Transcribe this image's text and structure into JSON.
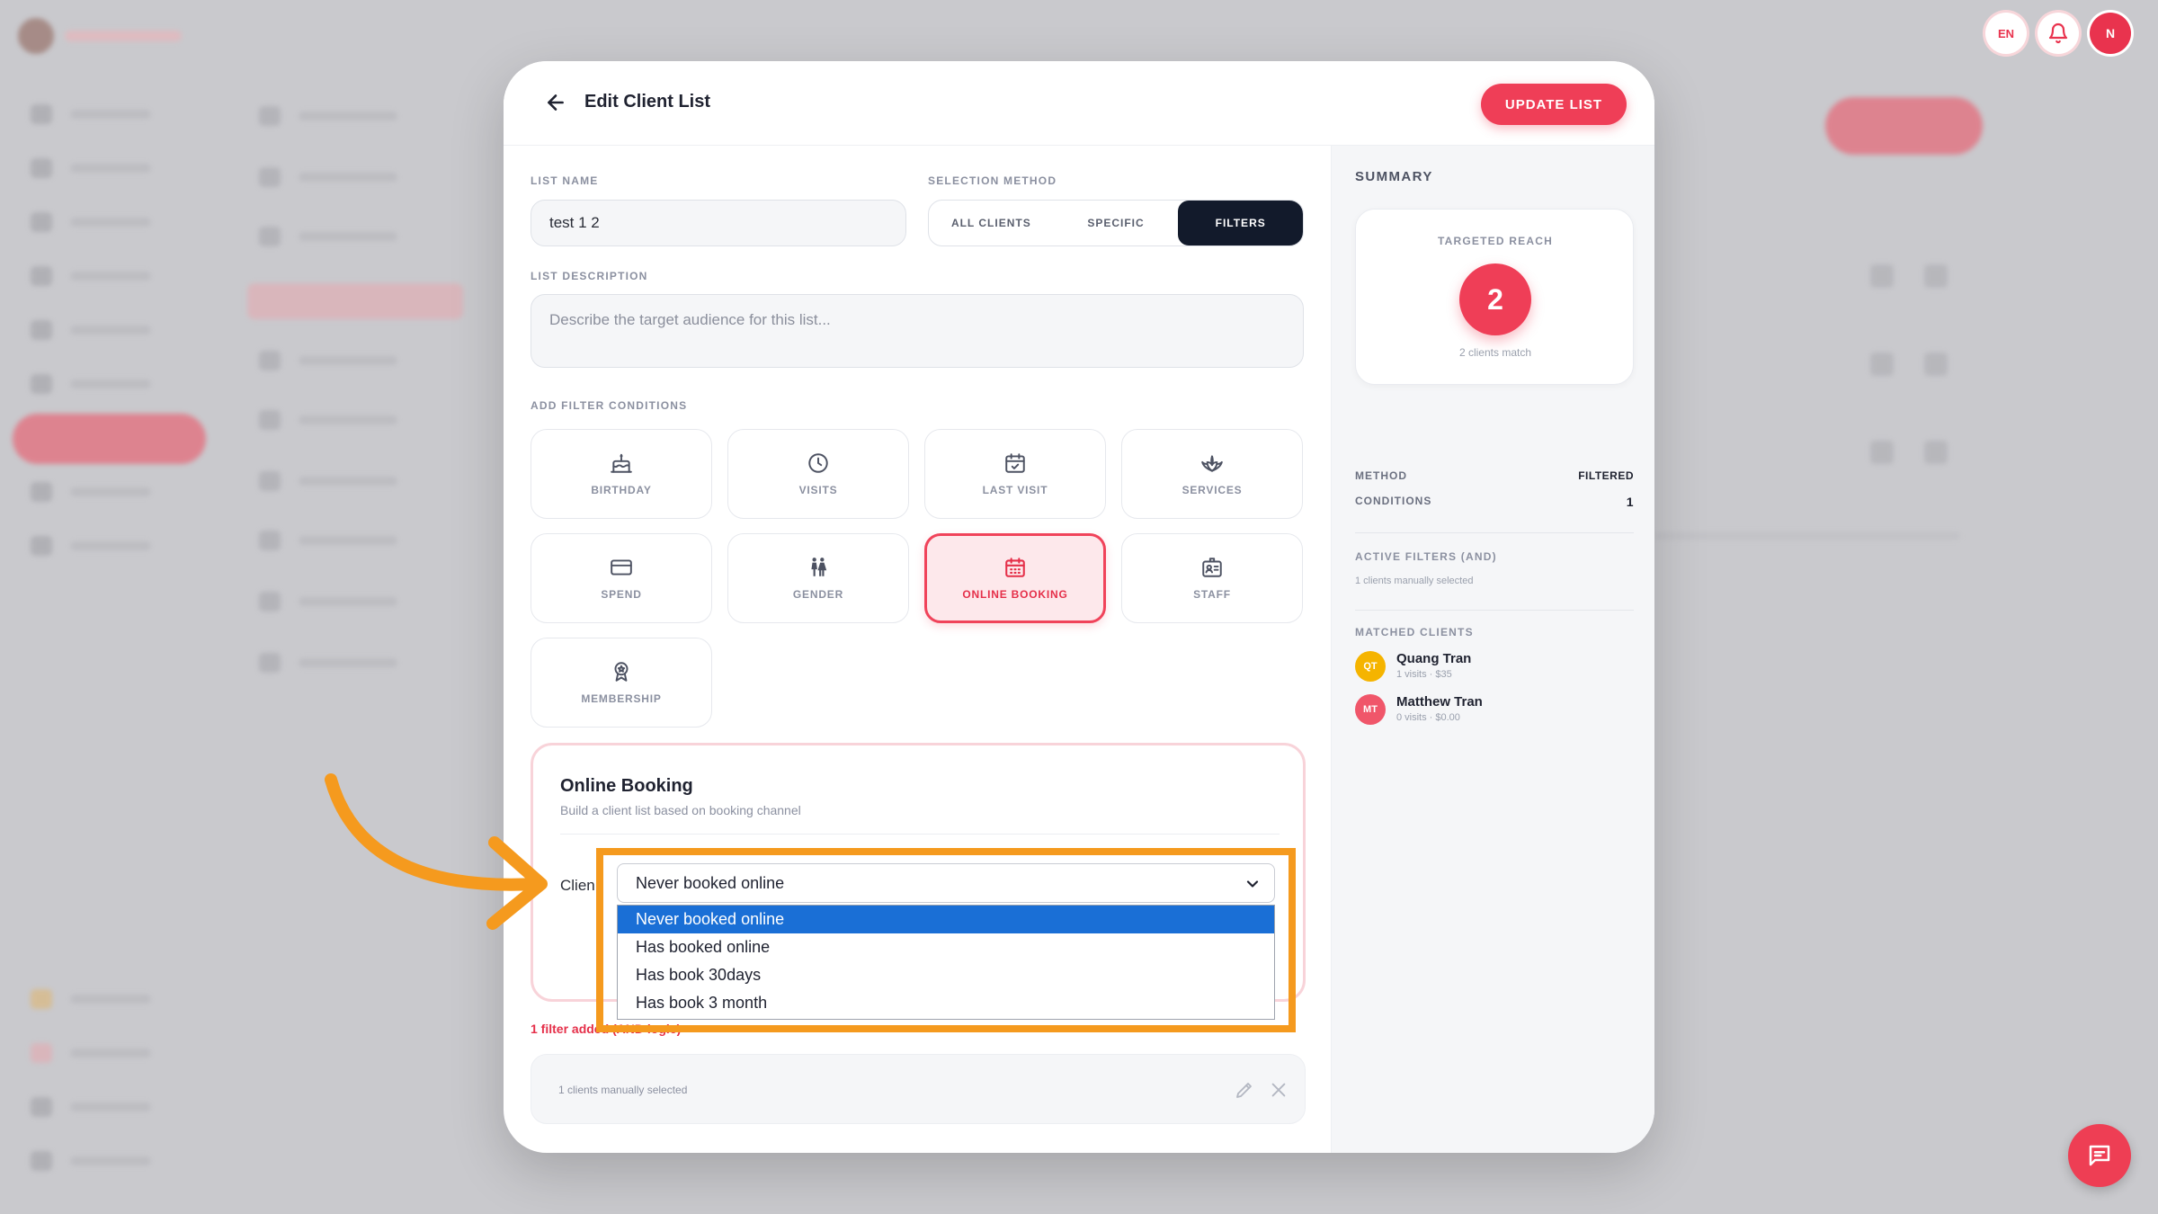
{
  "top_bar": {
    "lang": "EN",
    "avatar_initial": "N"
  },
  "modal": {
    "title": "Edit Client List",
    "update_button": "UPDATE LIST",
    "list_name_label": "LIST NAME",
    "list_name_value": "test 1 2",
    "selection_method_label": "SELECTION METHOD",
    "selection_methods": [
      "ALL CLIENTS",
      "SPECIFIC",
      "FILTERS"
    ],
    "selected_method": "FILTERS",
    "list_description_label": "LIST DESCRIPTION",
    "list_description_placeholder": "Describe the target audience for this list...",
    "filter_conditions_label": "ADD FILTER CONDITIONS",
    "filters": [
      {
        "label": "BIRTHDAY",
        "icon": "cake-icon"
      },
      {
        "label": "VISITS",
        "icon": "clock-icon"
      },
      {
        "label": "LAST VISIT",
        "icon": "calendar-check-icon"
      },
      {
        "label": "SERVICES",
        "icon": "lotus-icon"
      },
      {
        "label": "SPEND",
        "icon": "credit-card-icon"
      },
      {
        "label": "GENDER",
        "icon": "gender-icon"
      },
      {
        "label": "ONLINE BOOKING",
        "icon": "calendar-grid-icon",
        "active": true
      },
      {
        "label": "STAFF",
        "icon": "staff-badge-icon"
      },
      {
        "label": "MEMBERSHIP",
        "icon": "award-icon"
      }
    ],
    "online_booking_card": {
      "title": "Online Booking",
      "subtitle": "Build a client list based on booking channel",
      "field_label": "Clien",
      "selected_value": "Never booked online",
      "options": [
        "Never booked online",
        "Has booked online",
        "Has book 30days",
        "Has book 3 month"
      ]
    },
    "filter_count_text": "1 filter added (AND logic)",
    "manual_selection_text": "1 clients manually selected"
  },
  "summary": {
    "title": "SUMMARY",
    "targeted_reach_label": "TARGETED REACH",
    "targeted_reach_value": "2",
    "match_text": "2 clients match",
    "method_label": "METHOD",
    "method_value": "FILTERED",
    "conditions_label": "CONDITIONS",
    "conditions_value": "1",
    "active_filters_label": "ACTIVE FILTERS (AND)",
    "active_filters_note": "1 clients manually selected",
    "matched_clients_label": "MATCHED CLIENTS",
    "matched_clients": [
      {
        "initials": "QT",
        "name": "Quang Tran",
        "meta": "1 visits · $35",
        "color": "#f5b400"
      },
      {
        "initials": "MT",
        "name": "Matthew Tran",
        "meta": "0 visits · $0.00",
        "color": "#f0566a"
      }
    ]
  },
  "colors": {
    "accent": "#ef3e57",
    "dark": "#121a2b",
    "highlight": "#f59a1e",
    "option_selected": "#1a6fd6"
  }
}
